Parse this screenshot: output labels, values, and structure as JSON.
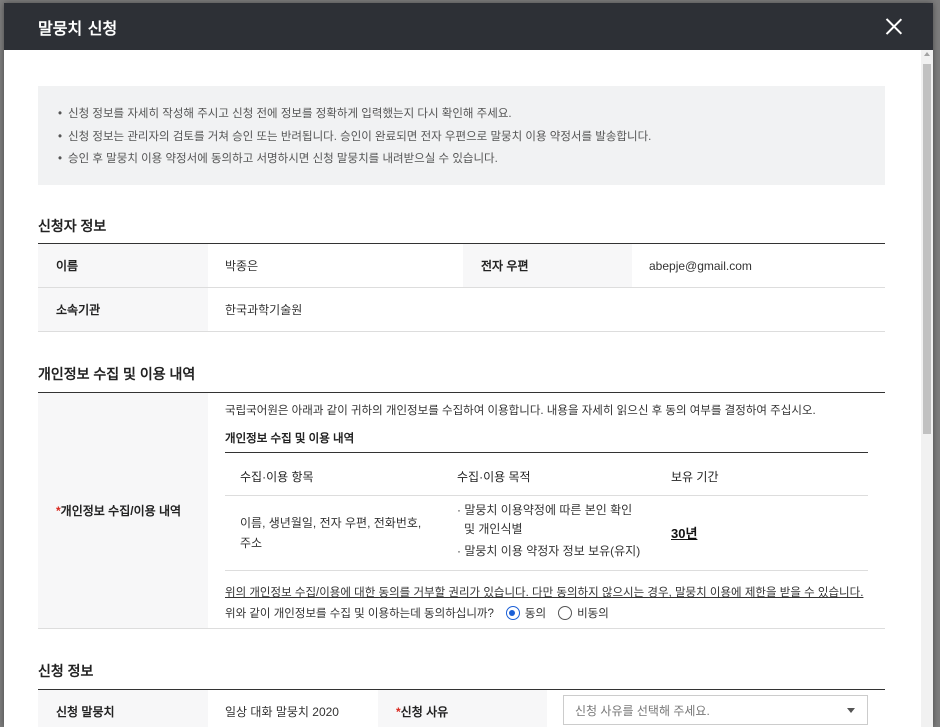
{
  "modal": {
    "title": "말뭉치 신청",
    "close_label": "×"
  },
  "notice": {
    "items": [
      "신청 정보를 자세히 작성해 주시고 신청 전에 정보를 정확하게 입력했는지 다시 확인해 주세요.",
      "신청 정보는 관리자의 검토를 거쳐 승인 또는 반려됩니다. 승인이 완료되면 전자 우편으로 말뭉치 이용 약정서를 발송합니다.",
      "승인 후 말뭉치 이용 약정서에 동의하고 서명하시면 신청 말뭉치를 내려받으실 수 있습니다."
    ]
  },
  "applicant": {
    "section_title": "신청자 정보",
    "name_label": "이름",
    "name_value": "박종은",
    "email_label": "전자 우편",
    "email_value": "abepje@gmail.com",
    "org_label": "소속기관",
    "org_value": "한국과학기술원"
  },
  "privacy": {
    "section_title": "개인정보 수집 및 이용 내역",
    "row_label_required": "*",
    "row_label": "개인정보 수집/이용 내역",
    "intro": "국립국어원은 아래과 같이 귀하의 개인정보를 수집하여 이용합니다. 내용을 자세히 읽으신 후 동의 여부를 결정하여 주십시오.",
    "sub_title": "개인정보 수집 및 이용 내역",
    "table": {
      "headers": [
        "수집·이용 항목",
        "수집·이용 목적",
        "보유 기간"
      ],
      "items_line1": "이름, 생년월일, 전자 우편, 전화번호,",
      "items_line2": "주소",
      "purpose_line1": "· 말뭉치 이용약정에 따른 본인 확인",
      "purpose_line2": "  및 개인식별",
      "purpose_line3": "· 말뭉치 이용 약정자 정보 보유(유지)",
      "period": "30년"
    },
    "warning": "위의 개인정보 수집/이용에 대한 동의를 거부할 권리가 있습니다. 다만 동의하지 않으시는 경우, 말뭉치 이용에 제한을 받을 수 있습니다.",
    "question": "위와 같이 개인정보를 수집 및 이용하는데 동의하십니까?",
    "agree_label": "동의",
    "disagree_label": "비동의",
    "selected": "동의"
  },
  "application": {
    "section_title": "신청 정보",
    "corpus_label": "신청 말뭉치",
    "corpus_value": "일상 대화 말뭉치 2020",
    "reason_required": "*",
    "reason_label": " 신청 사유",
    "reason_placeholder": "신청 사유를 선택해 주세요."
  }
}
